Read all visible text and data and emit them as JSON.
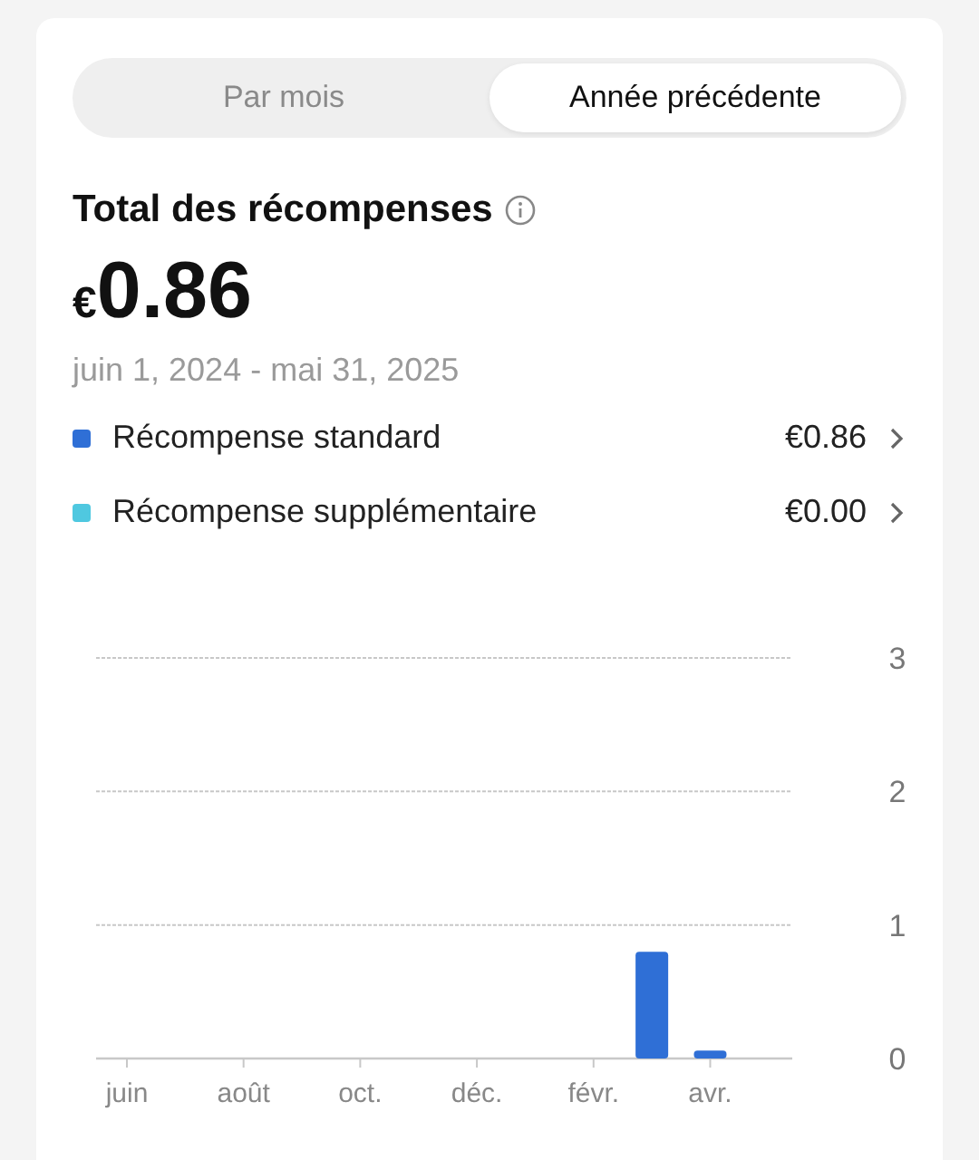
{
  "tabs": [
    {
      "label": "Par mois",
      "selected": false
    },
    {
      "label": "Année précédente",
      "selected": true
    }
  ],
  "summary": {
    "title": "Total des récompenses",
    "currency": "€",
    "amount": "0.86",
    "period": "juin 1, 2024 - mai 31, 2025"
  },
  "legend": [
    {
      "label": "Récompense standard",
      "value": "€0.86",
      "color": "#2f6fd6"
    },
    {
      "label": "Récompense supplémentaire",
      "value": "€0.00",
      "color": "#4fc8e0"
    }
  ],
  "chart_data": {
    "type": "bar",
    "categories": [
      "juin",
      null,
      "août",
      null,
      "oct.",
      null,
      "déc.",
      null,
      "févr.",
      null,
      "avr.",
      null
    ],
    "series": [
      {
        "color": "#2f6fd6",
        "values": [
          0,
          0,
          0,
          0,
          0,
          0,
          0,
          0,
          0,
          0.8,
          0.06,
          0
        ]
      }
    ],
    "ylim": [
      0,
      3
    ],
    "yticks": [
      0,
      1,
      2,
      3
    ]
  }
}
